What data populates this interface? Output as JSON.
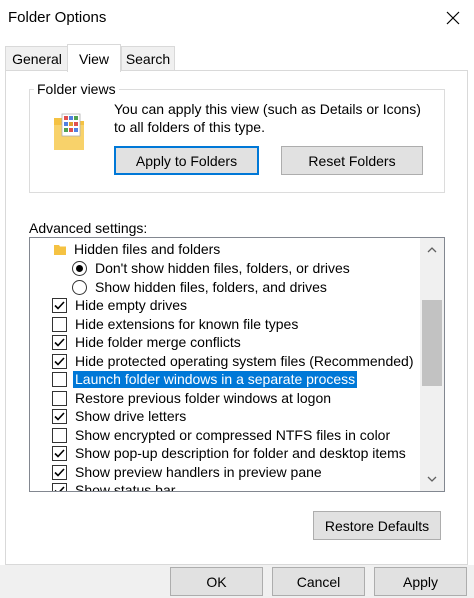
{
  "window": {
    "title": "Folder Options"
  },
  "tabs": [
    {
      "label": "General",
      "active": false
    },
    {
      "label": "View",
      "active": true
    },
    {
      "label": "Search",
      "active": false
    }
  ],
  "folder_views": {
    "group_label": "Folder views",
    "description": "You can apply this view (such as Details or Icons) to all folders of this type.",
    "apply_label": "Apply to Folders",
    "reset_label": "Reset Folders",
    "icon": "folder-views-icon"
  },
  "advanced": {
    "label": "Advanced settings:",
    "items": [
      {
        "type": "folder",
        "label": "Hidden files and folders"
      },
      {
        "type": "radio",
        "checked": true,
        "label": "Don't show hidden files, folders, or drives"
      },
      {
        "type": "radio",
        "checked": false,
        "label": "Show hidden files, folders, and drives"
      },
      {
        "type": "checkbox",
        "checked": true,
        "label": "Hide empty drives"
      },
      {
        "type": "checkbox",
        "checked": false,
        "label": "Hide extensions for known file types"
      },
      {
        "type": "checkbox",
        "checked": true,
        "label": "Hide folder merge conflicts"
      },
      {
        "type": "checkbox",
        "checked": true,
        "label": "Hide protected operating system files (Recommended)"
      },
      {
        "type": "checkbox",
        "checked": false,
        "label": "Launch folder windows in a separate process",
        "selected": true
      },
      {
        "type": "checkbox",
        "checked": false,
        "label": "Restore previous folder windows at logon"
      },
      {
        "type": "checkbox",
        "checked": true,
        "label": "Show drive letters"
      },
      {
        "type": "checkbox",
        "checked": false,
        "label": "Show encrypted or compressed NTFS files in color"
      },
      {
        "type": "checkbox",
        "checked": true,
        "label": "Show pop-up description for folder and desktop items"
      },
      {
        "type": "checkbox",
        "checked": true,
        "label": "Show preview handlers in preview pane"
      },
      {
        "type": "checkbox",
        "checked": true,
        "label": "Show status bar"
      }
    ],
    "restore_defaults_label": "Restore Defaults"
  },
  "footer": {
    "ok_label": "OK",
    "cancel_label": "Cancel",
    "apply_label": "Apply"
  },
  "colors": {
    "accent": "#0078d7",
    "button_face": "#e1e1e1",
    "footer_bg": "#f0f0f0",
    "folder": "#f5c242"
  }
}
